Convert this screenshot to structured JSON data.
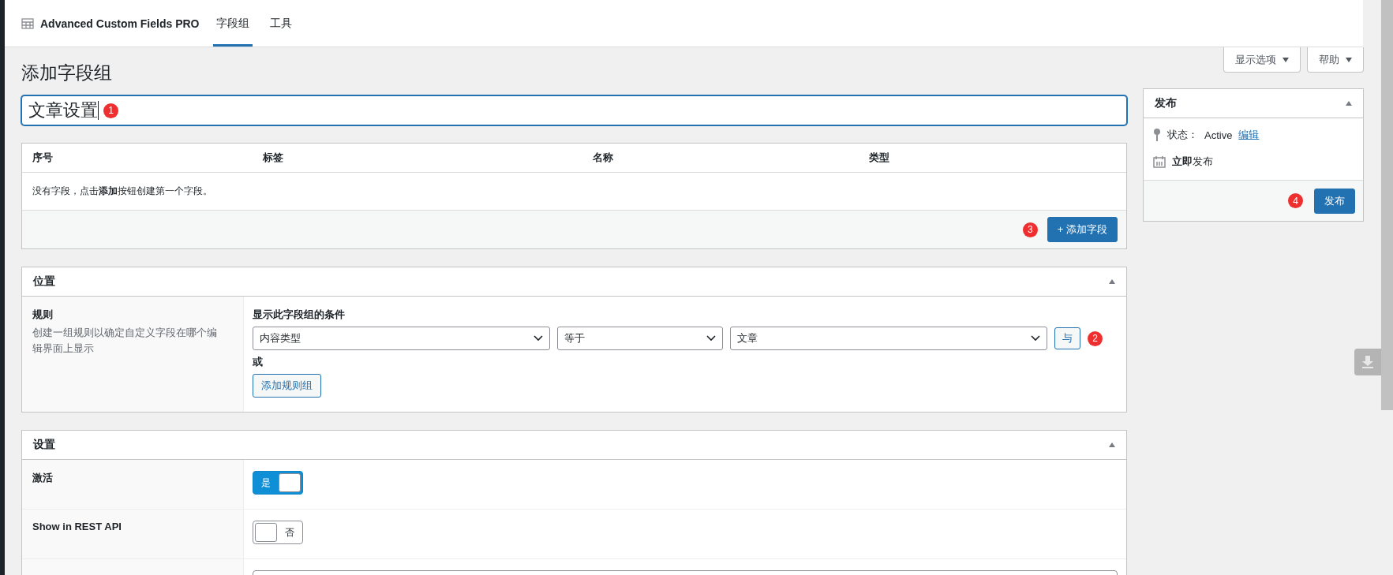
{
  "top_bar": {
    "brand": "Advanced Custom Fields PRO",
    "tabs": [
      {
        "label": "字段组",
        "selected": true
      },
      {
        "label": "工具",
        "selected": false
      }
    ]
  },
  "screen_buttons": [
    "显示选项",
    "帮助"
  ],
  "page_title": "添加字段组",
  "title_field": {
    "value": "文章设置",
    "badge": "1"
  },
  "fields_table": {
    "columns": [
      "序号",
      "标签",
      "名称",
      "类型"
    ],
    "empty_message": "没有字段，点击**添加**按钮创建第一个字段。",
    "badge": "3",
    "add_button": "+ 添加字段"
  },
  "location": {
    "title": "位置",
    "label": "规则",
    "description": "创建一组规则以确定自定义字段在哪个编辑界面上显示",
    "condition_title": "显示此字段组的条件",
    "rule": {
      "param": "内容类型",
      "operator": "等于",
      "value": "文章",
      "and_button": "与",
      "badge": "2"
    },
    "or_label": "或",
    "add_group_button": "添加规则组"
  },
  "settings": {
    "title": "设置",
    "rows": [
      {
        "kind": "toggle",
        "label": "激活",
        "on": true,
        "toggle_text": "是"
      },
      {
        "kind": "toggle",
        "label": "Show in REST API",
        "on": false,
        "toggle_text": "否"
      },
      {
        "kind": "text"
      }
    ]
  },
  "publish": {
    "title": "发布",
    "status_label": "状态：",
    "status_value": "Active",
    "edit_link": "编辑",
    "publish_time": "**立即**发布",
    "badge": "4",
    "button": "发布"
  }
}
